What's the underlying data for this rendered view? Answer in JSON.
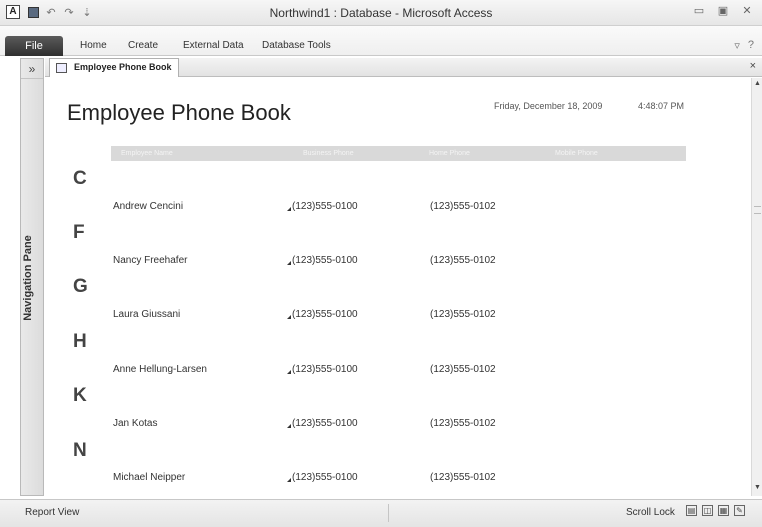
{
  "window": {
    "title": "Northwind1 : Database  -  Microsoft Access",
    "app_icon": "A",
    "qat_icons": [
      "save-icon",
      "undo-icon",
      "redo-icon",
      "customize-icon"
    ]
  },
  "ribbon": {
    "file": "File",
    "tabs": [
      "Home",
      "Create",
      "External Data",
      "Database Tools"
    ]
  },
  "nav": {
    "toggle": "»",
    "label": "Navigation Pane"
  },
  "document": {
    "tab_label": "Employee Phone Book",
    "close": "×"
  },
  "report": {
    "title": "Employee Phone Book",
    "date": "Friday, December 18, 2009",
    "time": "4:48:07 PM",
    "headers": [
      "Employee Name",
      "Business Phone",
      "Home Phone",
      "Mobile Phone"
    ],
    "groups": [
      {
        "letter": "C",
        "name": "Andrew Cencini",
        "business": "(123)555-0100",
        "home": "(123)555-0102"
      },
      {
        "letter": "F",
        "name": "Nancy Freehafer",
        "business": "(123)555-0100",
        "home": "(123)555-0102"
      },
      {
        "letter": "G",
        "name": "Laura Giussani",
        "business": "(123)555-0100",
        "home": "(123)555-0102"
      },
      {
        "letter": "H",
        "name": "Anne Hellung-Larsen",
        "business": "(123)555-0100",
        "home": "(123)555-0102"
      },
      {
        "letter": "K",
        "name": "Jan Kotas",
        "business": "(123)555-0100",
        "home": "(123)555-0102"
      },
      {
        "letter": "N",
        "name": "Michael Neipper",
        "business": "(123)555-0100",
        "home": "(123)555-0102"
      }
    ]
  },
  "statusbar": {
    "left": "Report View",
    "scroll_lock": "Scroll Lock"
  }
}
